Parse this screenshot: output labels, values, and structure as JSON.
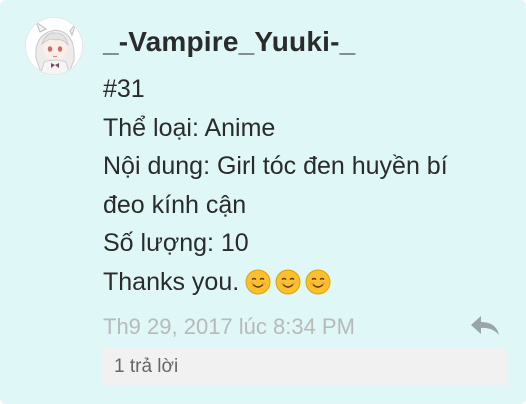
{
  "comment": {
    "username": "_-Vampire_Yuuki-_",
    "lines": [
      "#31",
      "Thể loại: Anime",
      "Nội dung: Girl tóc đen huyền bí",
      "đeo kính cận",
      "Số lượng: 10",
      "Thanks you."
    ],
    "emojis": [
      "smiling-face-icon",
      "smiling-face-icon",
      "smiling-face-icon"
    ],
    "timestamp": "Th9 29, 2017 lúc 8:34 PM",
    "reply_icon": "reply-arrow-icon",
    "replies_label": "1 trả lời"
  },
  "colors": {
    "card_background": "#dff7f7",
    "text": "#2b2b2b",
    "timestamp": "#b9b9b9",
    "replies_background": "#f1f1f1",
    "emoji_fill": "#fbc02d"
  }
}
